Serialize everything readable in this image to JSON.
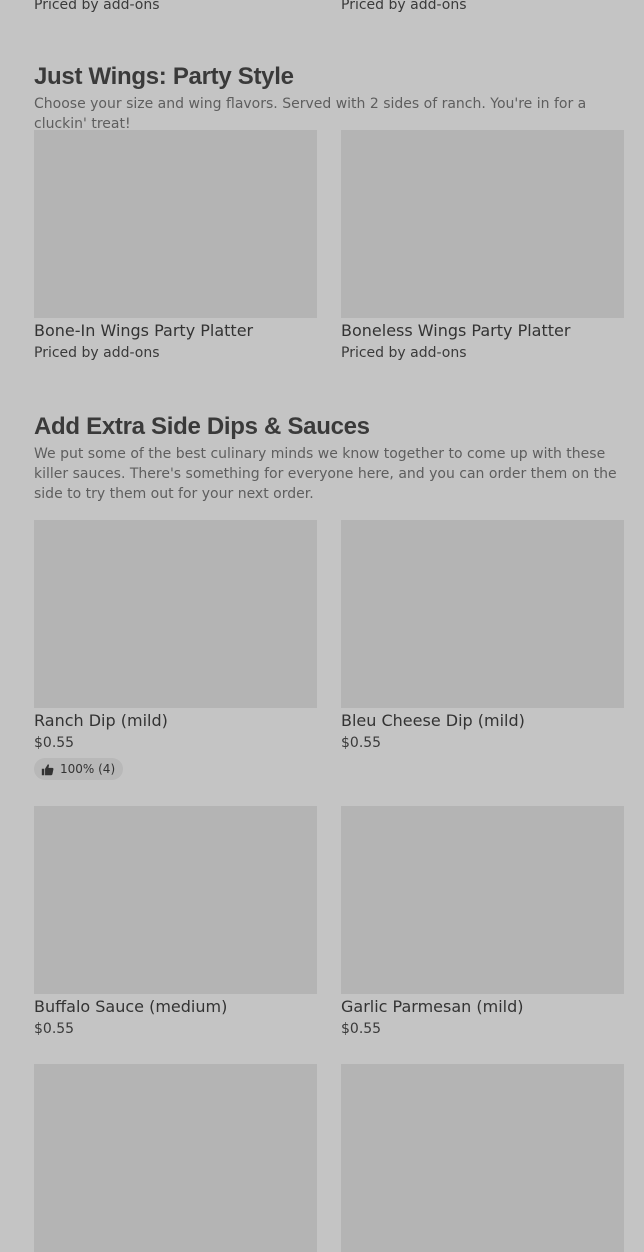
{
  "top_row": {
    "left_price": "Priced by add-ons",
    "right_price": "Priced by add-ons"
  },
  "sections": [
    {
      "title": "Just Wings: Party Style",
      "description": "Choose your size and wing flavors. Served with 2 sides of ranch. You're in for a cluckin' treat!",
      "items": [
        {
          "name": "Bone-In Wings Party Platter",
          "price": "Priced by add-ons"
        },
        {
          "name": "Boneless Wings Party Platter",
          "price": "Priced by add-ons"
        }
      ]
    },
    {
      "title": "Add Extra Side Dips & Sauces",
      "description": "We put some of the best culinary minds we know together to come up with these killer sauces. There's something for everyone here, and you can order them on the side to try them out for your next order.",
      "items": [
        {
          "name": "Ranch Dip (mild)",
          "price": "$0.55",
          "rating": {
            "icon": "thumbs-up-icon",
            "text": "100% (4)"
          }
        },
        {
          "name": "Bleu Cheese Dip (mild)",
          "price": "$0.55"
        },
        {
          "name": "Buffalo Sauce (medium)",
          "price": "$0.55"
        },
        {
          "name": "Garlic Parmesan (mild)",
          "price": "$0.55"
        }
      ]
    }
  ]
}
